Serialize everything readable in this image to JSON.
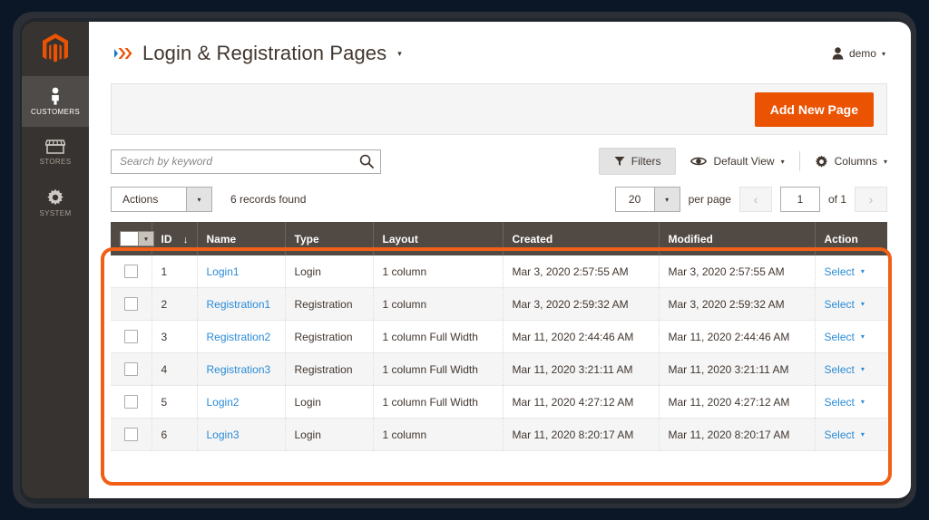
{
  "window": {
    "background_color": "#0b1726",
    "frame_color": "#2c2f36"
  },
  "sidebar": {
    "logo": {
      "name": "magento-logo",
      "color": "#eb5202"
    },
    "items": [
      {
        "label": "CUSTOMERS",
        "icon": "customers-icon",
        "active": true
      },
      {
        "label": "STORES",
        "icon": "stores-icon",
        "active": false
      },
      {
        "label": "SYSTEM",
        "icon": "system-gear-icon",
        "active": false
      }
    ]
  },
  "header": {
    "title": "Login & Registration Pages",
    "title_caret": "▾",
    "title_icon": "page-builder-chevrons-icon",
    "user": {
      "icon": "user-avatar-icon",
      "name": "demo",
      "caret": "▾"
    }
  },
  "page_actions": {
    "add_new_page_label": "Add New Page",
    "accent_color": "#eb5202"
  },
  "toolbar": {
    "search": {
      "placeholder": "Search by keyword",
      "value": "",
      "icon": "search-icon"
    },
    "filters_label": "Filters",
    "filters_icon": "funnel-icon",
    "view_label": "Default View",
    "view_icon": "eye-icon",
    "view_caret": "▾",
    "columns_label": "Columns",
    "columns_icon": "gear-icon",
    "columns_caret": "▾"
  },
  "subtoolbar": {
    "actions_label": "Actions",
    "actions_caret": "▾",
    "records_found": "6 records found",
    "per_page_value": "20",
    "per_page_caret": "▾",
    "per_page_label": "per page",
    "prev_glyph": "‹",
    "next_glyph": "›",
    "page_value": "1",
    "page_of_label": "of 1"
  },
  "grid": {
    "columns": [
      {
        "key": "checkbox",
        "label": ""
      },
      {
        "key": "id",
        "label": "ID",
        "sort": "↓"
      },
      {
        "key": "name",
        "label": "Name"
      },
      {
        "key": "type",
        "label": "Type"
      },
      {
        "key": "layout",
        "label": "Layout"
      },
      {
        "key": "created",
        "label": "Created"
      },
      {
        "key": "modified",
        "label": "Modified"
      },
      {
        "key": "action",
        "label": "Action"
      }
    ],
    "action_label": "Select",
    "action_caret": "▾",
    "link_color": "#2a8bd6",
    "header_color": "#514943",
    "rows": [
      {
        "id": "1",
        "name": "Login1",
        "type": "Login",
        "layout": "1 column",
        "created": "Mar 3, 2020 2:57:55 AM",
        "modified": "Mar 3, 2020 2:57:55 AM"
      },
      {
        "id": "2",
        "name": "Registration1",
        "type": "Registration",
        "layout": "1 column",
        "created": "Mar 3, 2020 2:59:32 AM",
        "modified": "Mar 3, 2020 2:59:32 AM"
      },
      {
        "id": "3",
        "name": "Registration2",
        "type": "Registration",
        "layout": "1 column Full Width",
        "created": "Mar 11, 2020 2:44:46 AM",
        "modified": "Mar 11, 2020 2:44:46 AM"
      },
      {
        "id": "4",
        "name": "Registration3",
        "type": "Registration",
        "layout": "1 column Full Width",
        "created": "Mar 11, 2020 3:21:11 AM",
        "modified": "Mar 11, 2020 3:21:11 AM"
      },
      {
        "id": "5",
        "name": "Login2",
        "type": "Login",
        "layout": "1 column Full Width",
        "created": "Mar 11, 2020 4:27:12 AM",
        "modified": "Mar 11, 2020 4:27:12 AM"
      },
      {
        "id": "6",
        "name": "Login3",
        "type": "Login",
        "layout": "1 column",
        "created": "Mar 11, 2020 8:20:17 AM",
        "modified": "Mar 11, 2020 8:20:17 AM"
      }
    ]
  },
  "annotation": {
    "name": "orange-highlight-box",
    "color": "#ef6016"
  }
}
